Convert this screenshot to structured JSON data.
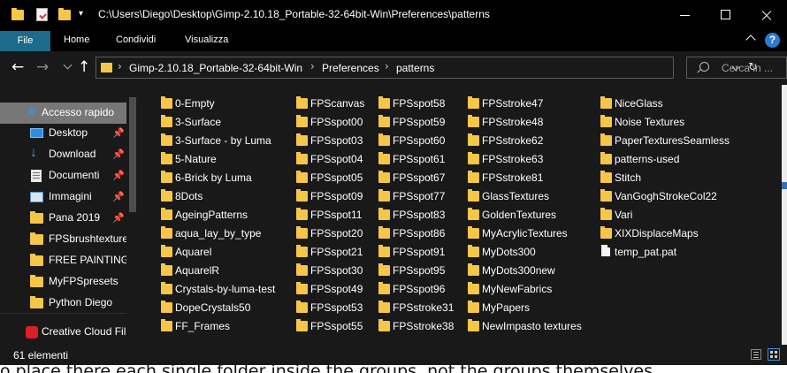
{
  "window": {
    "title_path": "C:\\Users\\Diego\\Desktop\\Gimp-2.10.18_Portable-32-64bit-Win\\Preferences\\patterns"
  },
  "ribbon": {
    "tabs": [
      "File",
      "Home",
      "Condividi",
      "Visualizza"
    ]
  },
  "address": {
    "crumbs": [
      "Gimp-2.10.18_Portable-32-64bit-Win",
      "Preferences",
      "patterns"
    ]
  },
  "search": {
    "placeholder": "Cerca in ..."
  },
  "sidebar": {
    "items": [
      {
        "label": "Accesso rapido",
        "icon": "star-icon",
        "pinned": false
      },
      {
        "label": "Desktop",
        "icon": "desktop-icon",
        "pinned": true
      },
      {
        "label": "Download",
        "icon": "download-icon",
        "pinned": true
      },
      {
        "label": "Documenti",
        "icon": "documents-icon",
        "pinned": true
      },
      {
        "label": "Immagini",
        "icon": "images-icon",
        "pinned": true
      },
      {
        "label": "Pana 2019",
        "icon": "folder-icon",
        "pinned": true
      },
      {
        "label": "FPSbrushtexture",
        "icon": "folder-icon",
        "pinned": false
      },
      {
        "label": "FREE PAINTING F",
        "icon": "folder-icon",
        "pinned": false
      },
      {
        "label": "MyFPSpresets",
        "icon": "folder-icon",
        "pinned": false
      },
      {
        "label": "Python Diego",
        "icon": "folder-icon",
        "pinned": false
      },
      {
        "label": "Creative Cloud Fil",
        "icon": "creative-cloud-icon",
        "pinned": false
      }
    ]
  },
  "files": {
    "col1": [
      "0-Empty",
      "3-Surface",
      "3-Surface - by Luma",
      "5-Nature",
      "6-Brick by Luma",
      "8Dots",
      "AgeingPatterns",
      "aqua_lay_by_type",
      "Aquarel",
      "AquarelR",
      "Crystals-by-luma-test",
      "DopeCrystals50",
      "FF_Frames"
    ],
    "col2": [
      "FPScanvas",
      "FPSspot00",
      "FPSspot03",
      "FPSspot04",
      "FPSspot05",
      "FPSspot09",
      "FPSspot11",
      "FPSspot20",
      "FPSspot21",
      "FPSspot30",
      "FPSspot49",
      "FPSspot53",
      "FPSspot55"
    ],
    "col3": [
      "FPSspot58",
      "FPSspot59",
      "FPSspot60",
      "FPSspot61",
      "FPSspot67",
      "FPSspot77",
      "FPSspot83",
      "FPSspot86",
      "FPSspot91",
      "FPSspot95",
      "FPSspot96",
      "FPSstroke31",
      "FPSstroke38"
    ],
    "col4": [
      "FPSstroke47",
      "FPSstroke48",
      "FPSstroke62",
      "FPSstroke63",
      "FPSstroke81",
      "GlassTextures",
      "GoldenTextures",
      "MyAcrylicTextures",
      "MyDots300",
      "MyDots300new",
      "MyNewFabrics",
      "MyPapers",
      "NewImpasto textures"
    ],
    "col5": [
      "NiceGlass",
      "Noise Textures",
      "PaperTexturesSeamless",
      "patterns-used",
      "Stitch",
      "VanGoghStrokeCol22",
      "Vari",
      "XIXDisplaceMaps",
      "temp_pat.pat"
    ],
    "file_items": [
      "temp_pat.pat"
    ]
  },
  "status": {
    "count": "61 elementi"
  },
  "background_text": "o place there each single folder inside the groups, not the groups themselves",
  "colors": {
    "folder": "#f6c648",
    "file_tab": "#1c6b8a",
    "selected": "#777777",
    "bg": "#191919"
  }
}
